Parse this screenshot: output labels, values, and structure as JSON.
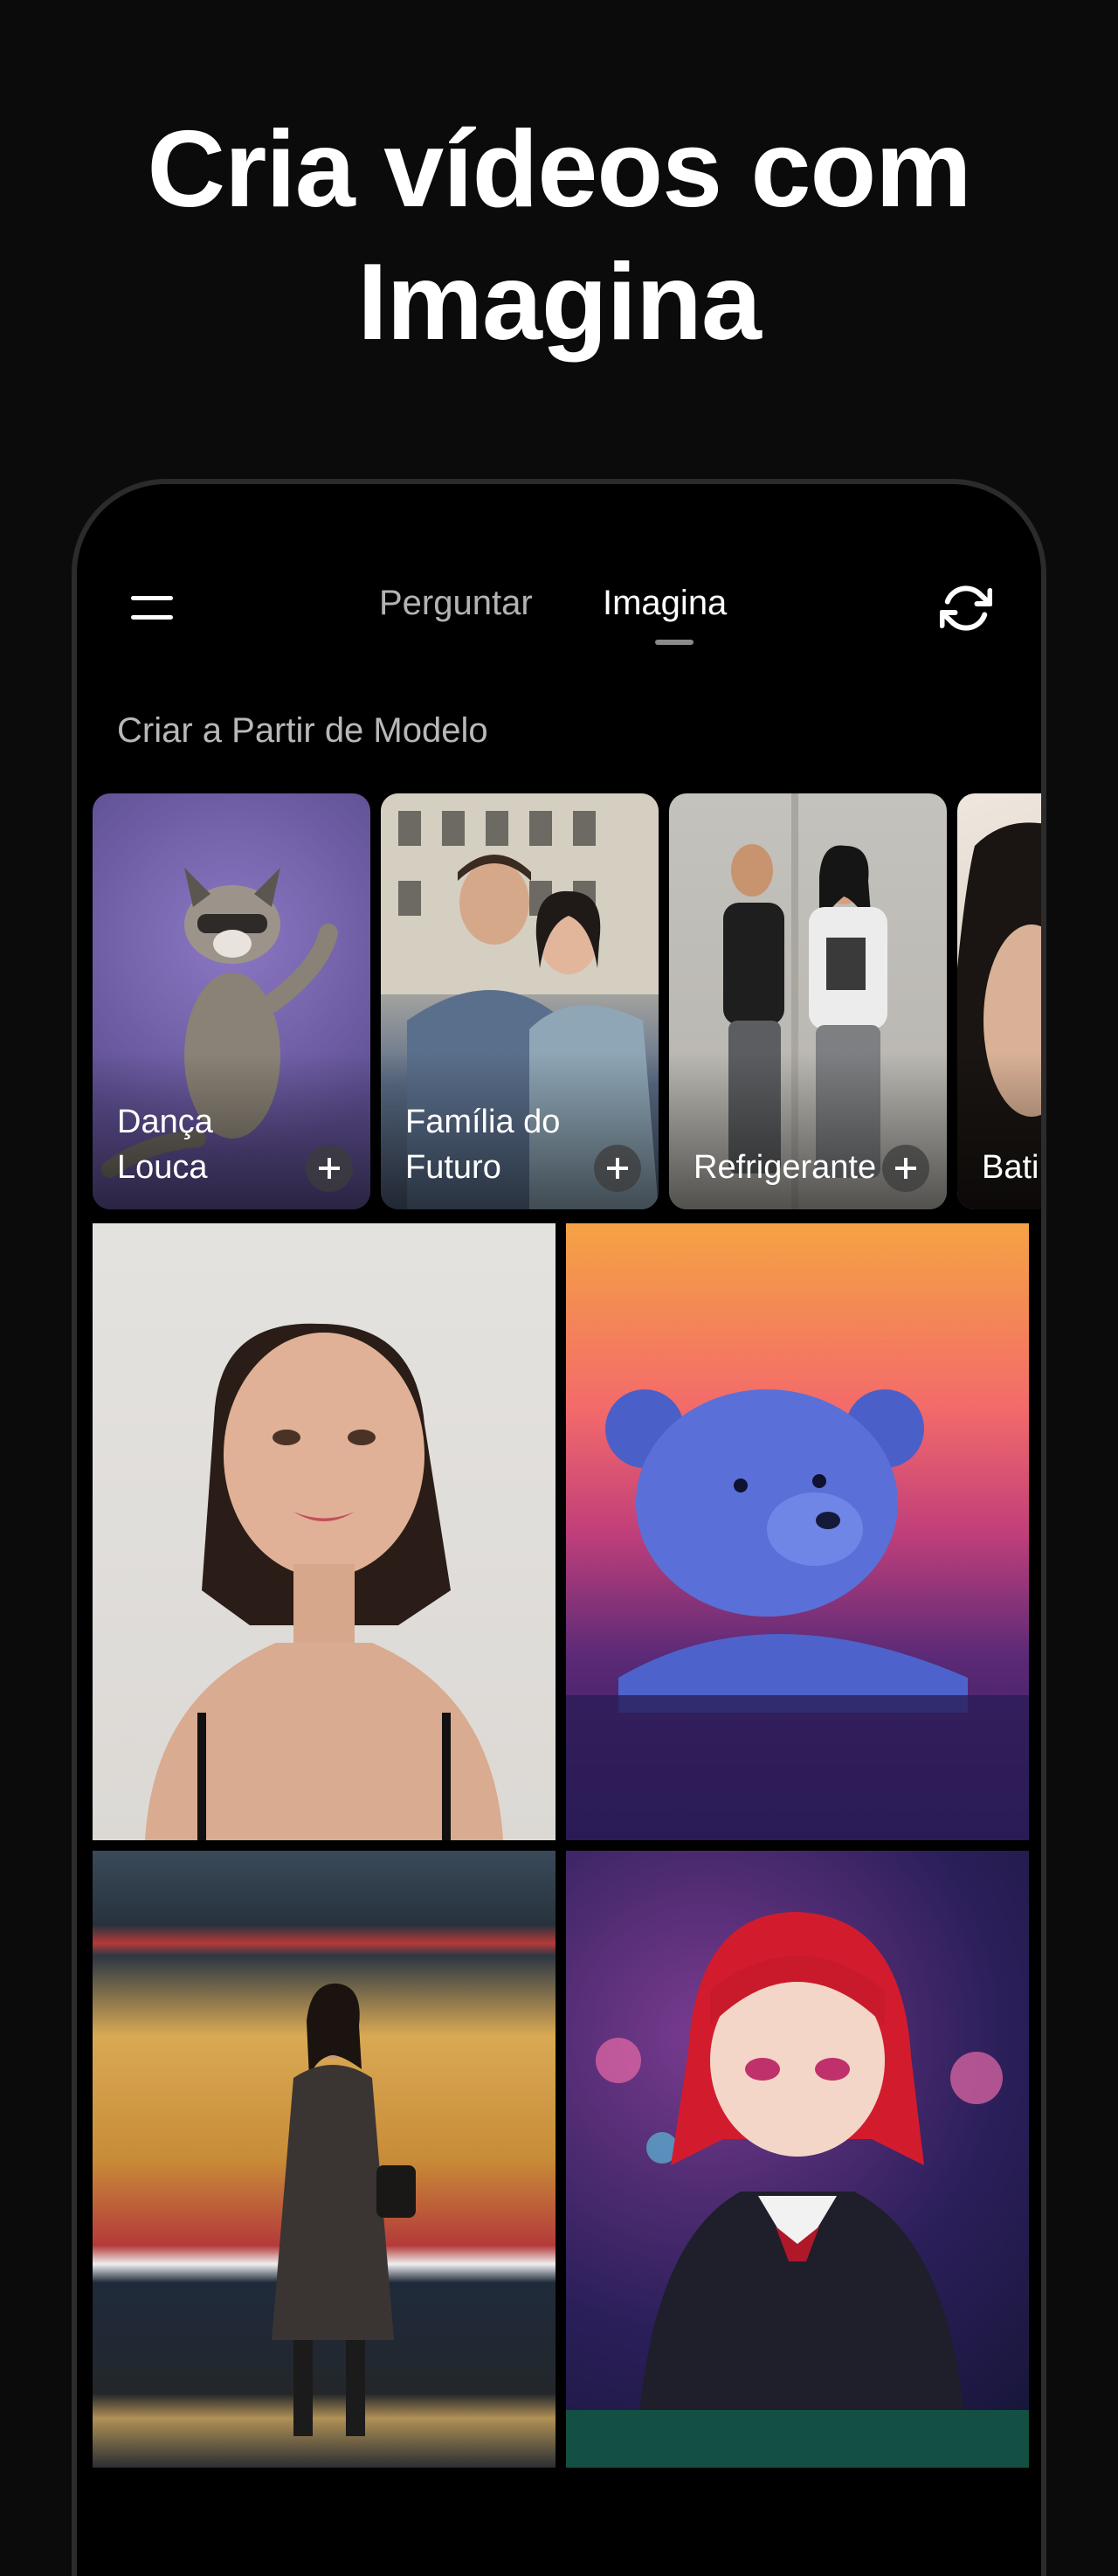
{
  "headline": {
    "line1": "Cria vídeos com",
    "line2": "Imagina"
  },
  "topbar": {
    "tabs": [
      {
        "label": "Perguntar",
        "active": false
      },
      {
        "label": "Imagina",
        "active": true
      }
    ],
    "menu_icon": "hamburger-menu-icon",
    "refresh_icon": "refresh-icon"
  },
  "section": {
    "title": "Criar a Partir de Modelo"
  },
  "templates": [
    {
      "label": "Dança Louca"
    },
    {
      "label": "Família do Futuro"
    },
    {
      "label": "Refrigerante"
    },
    {
      "label": "Bati de C"
    }
  ],
  "gallery": [
    {
      "subject": "portrait-woman"
    },
    {
      "subject": "blue-teddy-bear-in-water"
    },
    {
      "subject": "woman-walking-subway"
    },
    {
      "subject": "anime-girl-casino"
    }
  ],
  "colors": {
    "background": "#0b0b0b",
    "text": "#ffffff",
    "muted": "#b3b3b3"
  }
}
